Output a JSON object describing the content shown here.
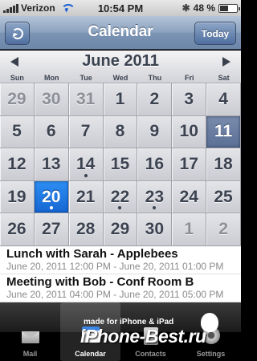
{
  "status_bar": {
    "carrier": "Verizon",
    "time": "10:54 PM",
    "battery": "48 %",
    "battery_level": 0.48,
    "icons": [
      "signal-icon",
      "wifi-icon",
      "bluetooth-icon",
      "battery-icon"
    ]
  },
  "nav": {
    "title": "Calendar",
    "today_label": "Today",
    "refresh_icon": "refresh-icon"
  },
  "calendar": {
    "month": "June 2011",
    "weekdays": [
      "Sun",
      "Mon",
      "Tue",
      "Wed",
      "Thu",
      "Fri",
      "Sat"
    ],
    "days": [
      {
        "d": "29",
        "other": true
      },
      {
        "d": "30",
        "other": true
      },
      {
        "d": "31",
        "other": true
      },
      {
        "d": "1"
      },
      {
        "d": "2"
      },
      {
        "d": "3"
      },
      {
        "d": "4"
      },
      {
        "d": "5"
      },
      {
        "d": "6"
      },
      {
        "d": "7"
      },
      {
        "d": "8"
      },
      {
        "d": "9"
      },
      {
        "d": "10"
      },
      {
        "d": "11",
        "today": true
      },
      {
        "d": "12"
      },
      {
        "d": "13"
      },
      {
        "d": "14",
        "dot": true
      },
      {
        "d": "15"
      },
      {
        "d": "16"
      },
      {
        "d": "17"
      },
      {
        "d": "18"
      },
      {
        "d": "19"
      },
      {
        "d": "20",
        "selected": true,
        "dot": true
      },
      {
        "d": "21"
      },
      {
        "d": "22",
        "dot": true
      },
      {
        "d": "23",
        "dot": true
      },
      {
        "d": "24"
      },
      {
        "d": "25"
      },
      {
        "d": "26"
      },
      {
        "d": "27"
      },
      {
        "d": "28"
      },
      {
        "d": "29"
      },
      {
        "d": "30"
      },
      {
        "d": "1",
        "other": true
      },
      {
        "d": "2",
        "other": true
      }
    ],
    "colors": {
      "selected": "#1a78e6",
      "today": "#6a7ea3",
      "cell": "#d8d9de"
    }
  },
  "events": [
    {
      "title": "Lunch with Sarah - Applebees",
      "time": "June 20, 2011 12:00 PM - June 20, 2011 01:00 PM"
    },
    {
      "title": "Meeting with Bob - Conf Room B",
      "time": "June 20, 2011 04:00 PM - June 20, 2011 05:00 PM"
    }
  ],
  "tabs": [
    {
      "label": "Mail",
      "icon": "mail-icon",
      "active": false
    },
    {
      "label": "Calendar",
      "icon": "calendar-icon",
      "active": true
    },
    {
      "label": "Contacts",
      "icon": "contacts-icon",
      "active": false
    },
    {
      "label": "Settings",
      "icon": "settings-icon",
      "active": false
    }
  ],
  "watermark": {
    "top": "made for iPhone & iPad",
    "main": "iPhone-Best.ru"
  }
}
